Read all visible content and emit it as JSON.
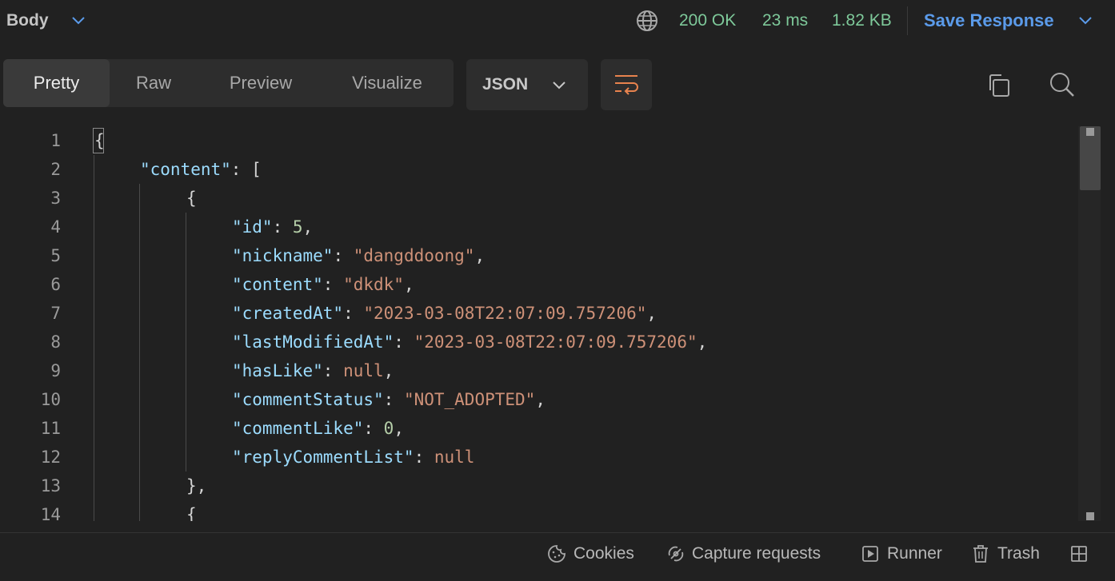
{
  "header": {
    "body_label": "Body",
    "status": "200 OK",
    "time": "23 ms",
    "size": "1.82 KB",
    "save_response": "Save Response"
  },
  "toolbar": {
    "tabs": [
      {
        "label": "Pretty",
        "active": true
      },
      {
        "label": "Raw",
        "active": false
      },
      {
        "label": "Preview",
        "active": false
      },
      {
        "label": "Visualize",
        "active": false
      }
    ],
    "format": "JSON"
  },
  "editor": {
    "line_numbers": [
      "1",
      "2",
      "3",
      "4",
      "5",
      "6",
      "7",
      "8",
      "9",
      "10",
      "11",
      "12",
      "13",
      "14"
    ],
    "lines": {
      "l1": {
        "brace": "{"
      },
      "l2": {
        "key": "\"content\"",
        "rest": ": ["
      },
      "l3": {
        "brace": "{"
      },
      "l4": {
        "key": "\"id\"",
        "sep": ": ",
        "value": "5",
        "end": ","
      },
      "l5": {
        "key": "\"nickname\"",
        "sep": ": ",
        "value": "\"dangddoong\"",
        "end": ","
      },
      "l6": {
        "key": "\"content\"",
        "sep": ": ",
        "value": "\"dkdk\"",
        "end": ","
      },
      "l7": {
        "key": "\"createdAt\"",
        "sep": ": ",
        "value": "\"2023-03-08T22:07:09.757206\"",
        "end": ","
      },
      "l8": {
        "key": "\"lastModifiedAt\"",
        "sep": ": ",
        "value": "\"2023-03-08T22:07:09.757206\"",
        "end": ","
      },
      "l9": {
        "key": "\"hasLike\"",
        "sep": ": ",
        "value": "null",
        "end": ","
      },
      "l10": {
        "key": "\"commentStatus\"",
        "sep": ": ",
        "value": "\"NOT_ADOPTED\"",
        "end": ","
      },
      "l11": {
        "key": "\"commentLike\"",
        "sep": ": ",
        "value": "0",
        "end": ","
      },
      "l12": {
        "key": "\"replyCommentList\"",
        "sep": ": ",
        "value": "null"
      },
      "l13": {
        "brace": "},"
      },
      "l14": {
        "brace": "{"
      }
    }
  },
  "statusbar": {
    "cookies": "Cookies",
    "capture": "Capture requests",
    "runner": "Runner",
    "trash": "Trash"
  },
  "colors": {
    "status_ok": "#7ec99a",
    "accent": "#5b9bea",
    "wrap_icon": "#e8834e",
    "key": "#9cdcfe",
    "string": "#ce9178",
    "number": "#b5cea8"
  },
  "icons": [
    "chevron-down-icon",
    "globe-icon",
    "wrap-lines-icon",
    "copy-icon",
    "search-icon",
    "cookie-icon",
    "capture-icon",
    "runner-icon",
    "trash-icon",
    "layout-icon"
  ]
}
